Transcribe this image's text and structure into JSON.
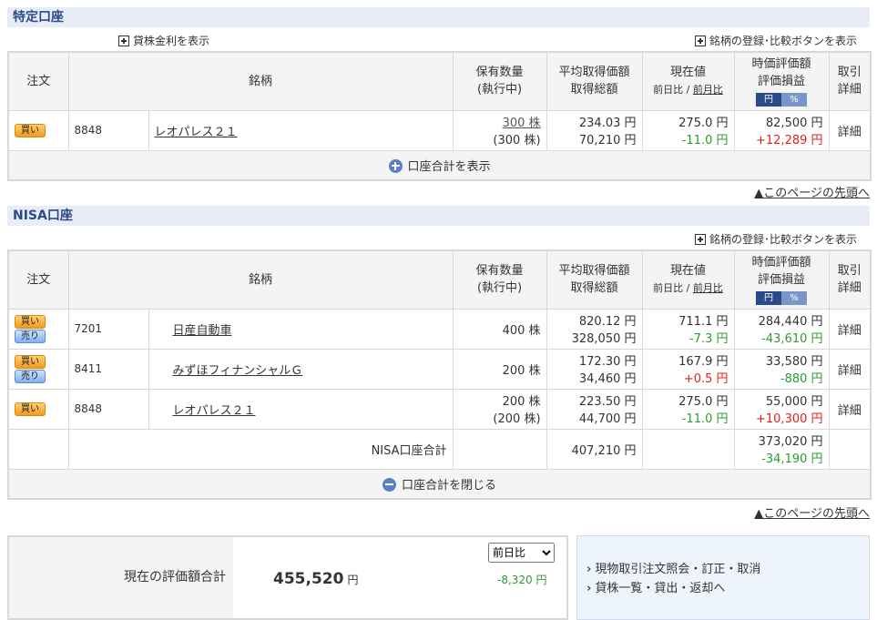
{
  "tokutei": {
    "title": "特定口座",
    "lending_link": "貸株金利を表示",
    "register_link": "銘柄の登録･比較ボタンを表示",
    "show_total": "口座合計を表示",
    "rows": [
      {
        "order": [
          "買い"
        ],
        "code": "8848",
        "name": "レオパレス２１",
        "qty": "300 株",
        "qty_exec": "(300 株)",
        "avg": "234.03 円",
        "total_cost": "70,210 円",
        "price": "275.0 円",
        "change": "-11.0 円",
        "value": "82,500 円",
        "pl": "+12,289 円",
        "detail": "詳細"
      }
    ]
  },
  "nisa": {
    "title": "NISA口座",
    "register_link": "銘柄の登録･比較ボタンを表示",
    "close_total": "口座合計を閉じる",
    "rows": [
      {
        "order": [
          "買い",
          "売り"
        ],
        "code": "7201",
        "name": "日産自動車",
        "qty": "400 株",
        "qty_exec": "",
        "avg": "820.12 円",
        "total_cost": "328,050 円",
        "price": "711.1 円",
        "change": "-7.3 円",
        "value": "284,440 円",
        "pl": "-43,610 円",
        "detail": "詳細"
      },
      {
        "order": [
          "買い",
          "売り"
        ],
        "code": "8411",
        "name": "みずほフィナンシャルＧ",
        "qty": "200 株",
        "qty_exec": "",
        "avg": "172.30 円",
        "total_cost": "34,460 円",
        "price": "167.9 円",
        "change": "+0.5 円",
        "value": "33,580 円",
        "pl": "-880 円",
        "detail": "詳細"
      },
      {
        "order": [
          "買い"
        ],
        "code": "8848",
        "name": "レオパレス２１",
        "qty": "200 株",
        "qty_exec": "(200 株)",
        "avg": "223.50 円",
        "total_cost": "44,700 円",
        "price": "275.0 円",
        "change": "-11.0 円",
        "value": "55,000 円",
        "pl": "+10,300 円",
        "detail": "詳細"
      }
    ],
    "total": {
      "label": "NISA口座合計",
      "cost": "407,210 円",
      "value": "373,020 円",
      "pl": "-34,190 円"
    }
  },
  "headers": {
    "order": "注文",
    "name": "銘柄",
    "qty1": "保有数量",
    "qty2": "(執行中)",
    "avg1": "平均取得価額",
    "avg2": "取得総額",
    "price1": "現在値",
    "price2a": "前日比",
    "price2b": "前月比",
    "val1": "時価評価額",
    "val2": "評価損益",
    "tog_yen": "円",
    "tog_pct": "%",
    "det1": "取引",
    "det2": "詳細"
  },
  "page_top": "▲このページの先頭へ",
  "summary": {
    "label": "現在の評価額合計",
    "total": "455,520",
    "unit": "円",
    "select": "前日比",
    "diff": "-8,320 円"
  },
  "links": [
    "現物取引注文照会・訂正・取消",
    "貸株一覧・貸出・返却へ"
  ]
}
